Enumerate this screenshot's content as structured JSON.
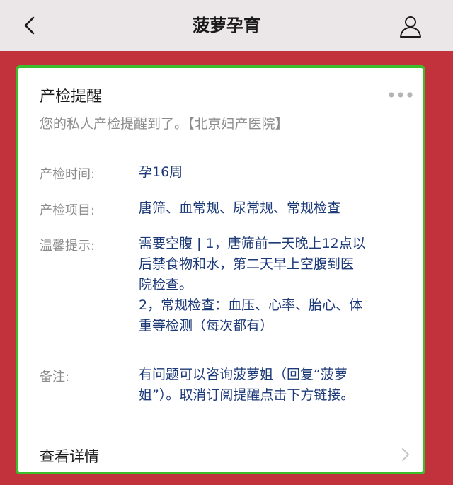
{
  "navbar": {
    "title": "菠萝孕育"
  },
  "card": {
    "title": "产检提醒",
    "subtitle": "您的私人产检提醒到了。【北京妇产医院】",
    "rows": [
      {
        "label": "产检时间:",
        "value": "孕16周"
      },
      {
        "label": "产检项目:",
        "value": "唐筛、血常规、尿常规、常规检查"
      },
      {
        "label": "温馨提示:",
        "value_lines": [
          "需要空腹 | 1，唐筛前一天晚上12点以",
          "后禁食物和水，第二天早上空腹到医",
          "院检查。",
          "2，常规检查：血压、心率、胎心、体",
          "重等检测（每次都有）"
        ]
      },
      {
        "label": "备注:",
        "value_lines": [
          "有问题可以咨询菠萝姐（回复“菠萝",
          "姐”）。取消订阅提醒点击下方链接。"
        ]
      }
    ],
    "detail_label": "查看详情"
  },
  "icons": {
    "back": "chevron-left-icon",
    "profile": "user-icon",
    "more": "more-dots-icon",
    "detail": "chevron-right-icon"
  },
  "colors": {
    "background": "#c2323c",
    "navbar": "#ebe7e8",
    "card_border": "#3cbd2c",
    "value_text": "#1d3a78",
    "label_text": "#8c8c8c"
  }
}
